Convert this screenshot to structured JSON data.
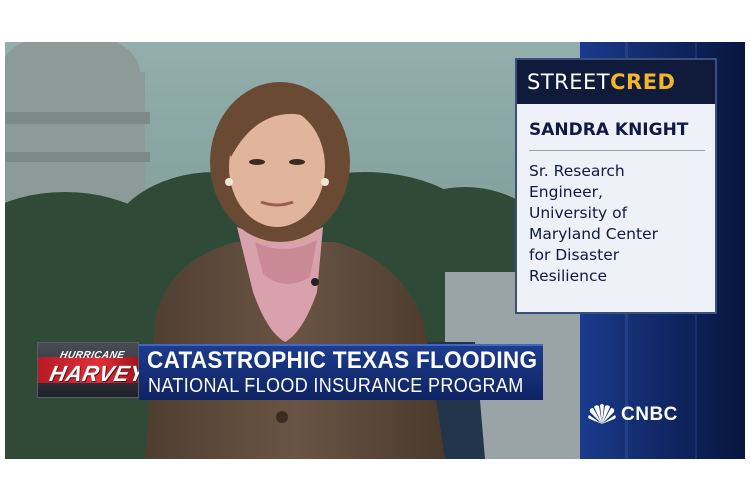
{
  "street_cred": {
    "label_street": "STREET",
    "label_cred": "CRED",
    "name": "SANDRA KNIGHT",
    "title": "Sr. Research\nEngineer,\nUniversity of\nMaryland Center\nfor Disaster\nResilience"
  },
  "show_logo": {
    "line1": "HURRICANE",
    "line2": "HARVEY"
  },
  "headline": {
    "main": "CATASTROPHIC TEXAS FLOODING",
    "sub": "NATIONAL FLOOD INSURANCE PROGRAM"
  },
  "network": {
    "name": "CNBC",
    "icon": "peacock-icon"
  },
  "colors": {
    "lower_third_blue": "#1d3c8e",
    "cred_gold": "#f2b627",
    "cred_header_navy": "#101a3a"
  }
}
